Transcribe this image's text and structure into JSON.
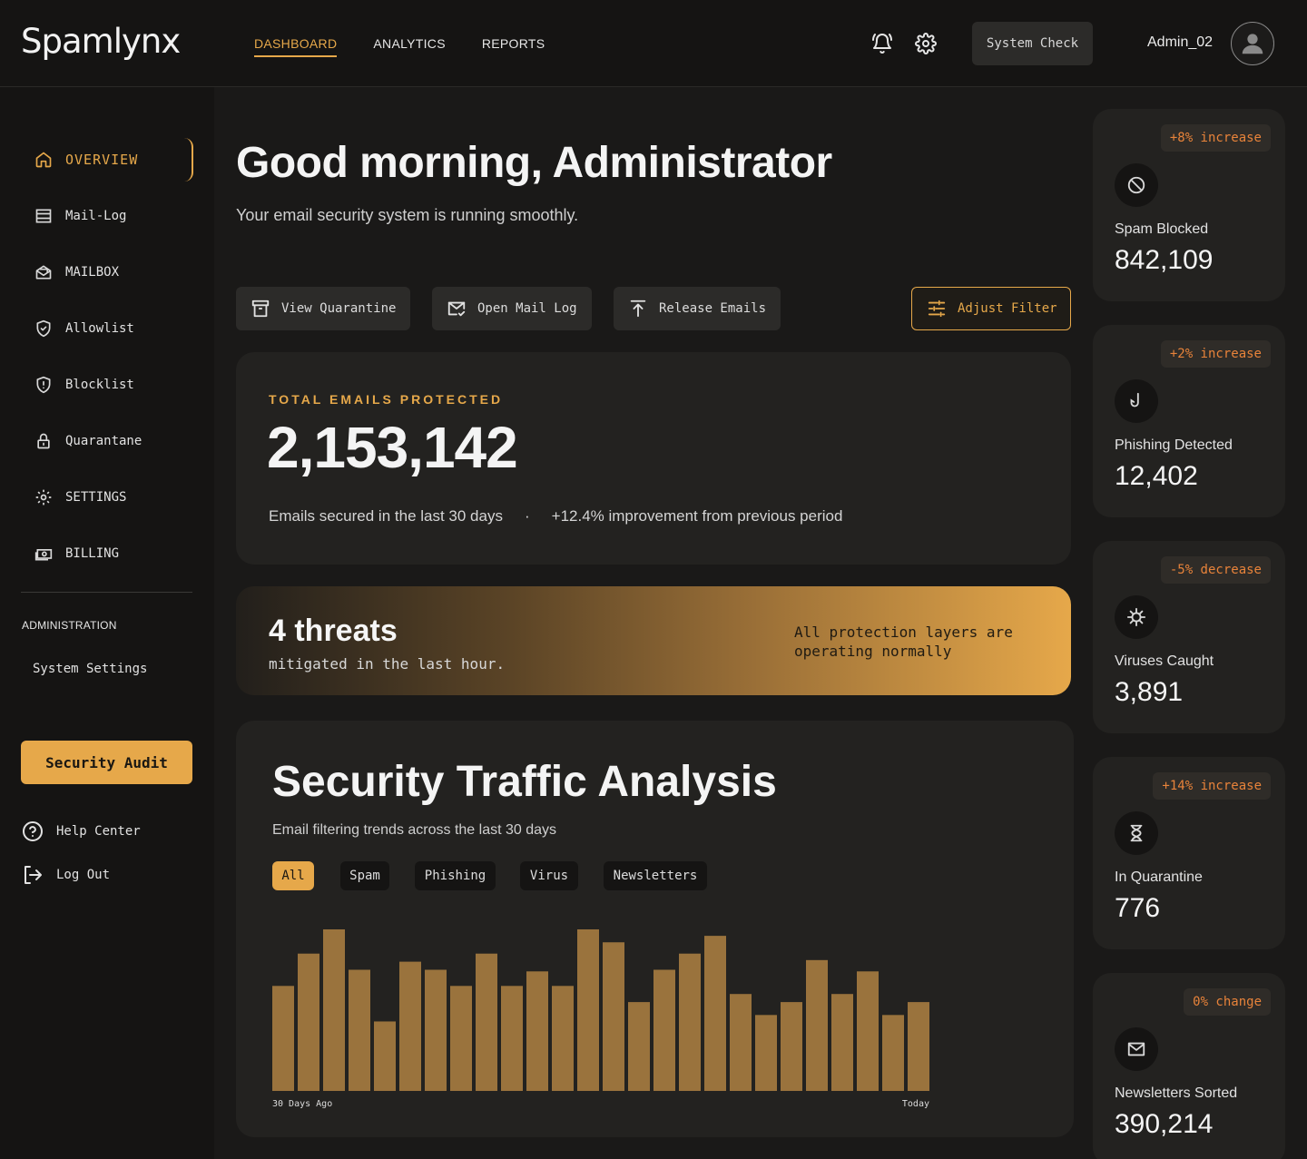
{
  "brand": {
    "name": "Spamlynx",
    "accent": "#e6a84a",
    "badge_color": "#e8833a"
  },
  "nav": [
    {
      "label": "DASHBOARD",
      "active": true
    },
    {
      "label": "ANALYTICS",
      "active": false
    },
    {
      "label": "REPORTS",
      "active": false
    }
  ],
  "header": {
    "bell_icon": "bell-icon",
    "gear_icon": "gear-icon",
    "system_check": "System Check",
    "user_name": "Admin_02",
    "avatar_icon": "user-avatar-icon"
  },
  "sidebar": {
    "items": [
      {
        "label": "OVERVIEW",
        "icon": "home-icon",
        "active": true
      },
      {
        "label": "Mail-Log",
        "icon": "inbox-icon"
      },
      {
        "label": "MAILBOX",
        "icon": "mail-open-icon"
      },
      {
        "label": "Allowlist",
        "icon": "shield-check-icon"
      },
      {
        "label": "Blocklist",
        "icon": "shield-alert-icon"
      },
      {
        "label": "Quarantane",
        "icon": "lock-icon"
      },
      {
        "label": "SETTINGS",
        "icon": "gear-icon"
      },
      {
        "label": "BILLING",
        "icon": "banknote-icon"
      }
    ],
    "admin_label": "ADMINISTRATION",
    "system_settings": "System Settings",
    "audit_button": "Security Audit",
    "help": "Help Center",
    "logout": "Log Out"
  },
  "main": {
    "greeting": "Good morning, Administrator",
    "subtitle": "Your email security system is running smoothly.",
    "actions": [
      {
        "label": "View Quarantine",
        "icon": "archive-icon"
      },
      {
        "label": "Open Mail Log",
        "icon": "mail-check-icon"
      },
      {
        "label": "Release Emails",
        "icon": "upload-icon"
      }
    ],
    "adjust_filter": "Adjust Filter",
    "total": {
      "label": "TOTAL EMAILS PROTECTED",
      "value": "2,153,142",
      "period": "Emails secured in the last 30 days",
      "separator": "·",
      "improvement": "+12.4% improvement from previous period"
    },
    "threats": {
      "title": "4 threats",
      "subtitle": "mitigated in the last hour.",
      "status": "All protection layers are operating normally"
    },
    "traffic": {
      "title": "Security Traffic Analysis",
      "subtitle": "Email filtering trends across the last 30 days",
      "filters": [
        {
          "label": "All",
          "active": true
        },
        {
          "label": "Spam"
        },
        {
          "label": "Phishing"
        },
        {
          "label": "Virus"
        },
        {
          "label": "Newsletters"
        }
      ]
    }
  },
  "chart_data": {
    "type": "bar",
    "title": "Security Traffic Analysis",
    "x_start_label": "30 Days Ago",
    "x_end_label": "Today",
    "values": [
      65,
      85,
      100,
      75,
      43,
      80,
      75,
      65,
      85,
      65,
      74,
      65,
      100,
      92,
      55,
      75,
      85,
      96,
      60,
      47,
      55,
      81,
      60,
      74,
      47,
      55
    ],
    "ylim": [
      0,
      100
    ],
    "grid": false,
    "color": "#9a733d"
  },
  "stats": [
    {
      "badge": "+8% increase",
      "icon": "ban-icon",
      "label": "Spam Blocked",
      "value": "842,109"
    },
    {
      "badge": "+2% increase",
      "icon": "fishhook-icon",
      "label": "Phishing Detected",
      "value": "12,402"
    },
    {
      "badge": "-5% decrease",
      "icon": "virus-icon",
      "label": "Viruses Caught",
      "value": "3,891"
    },
    {
      "badge": "+14% increase",
      "icon": "hourglass-icon",
      "label": "In Quarantine",
      "value": "776"
    },
    {
      "badge": "0% change",
      "icon": "envelope-icon",
      "label": "Newsletters Sorted",
      "value": "390,214"
    }
  ]
}
